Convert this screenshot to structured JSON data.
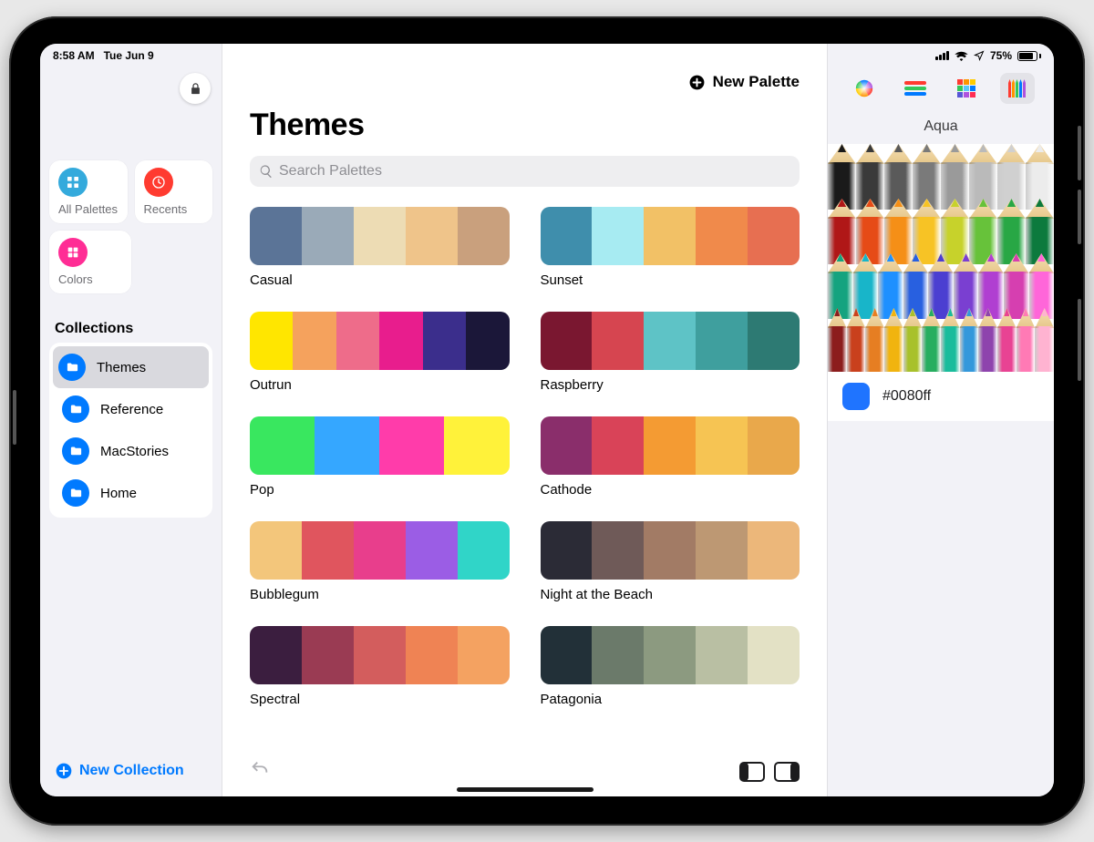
{
  "status": {
    "time": "8:58 AM",
    "date": "Tue Jun 9",
    "battery_pct": "75%"
  },
  "sidebar": {
    "tiles": [
      {
        "label": "All Palettes",
        "icon": "grid-icon",
        "color": "#34aadc"
      },
      {
        "label": "Recents",
        "icon": "clock-icon",
        "color": "#ff3b30"
      },
      {
        "label": "Colors",
        "icon": "swatch-icon",
        "color": "#ff2d95"
      }
    ],
    "section_title": "Collections",
    "collections": [
      {
        "label": "Themes",
        "selected": true
      },
      {
        "label": "Reference",
        "selected": false
      },
      {
        "label": "MacStories",
        "selected": false
      },
      {
        "label": "Home",
        "selected": false
      }
    ],
    "new_collection_label": "New Collection"
  },
  "main": {
    "new_palette_label": "New Palette",
    "title": "Themes",
    "search_placeholder": "Search Palettes",
    "palettes": [
      {
        "name": "Casual",
        "colors": [
          "#5b7497",
          "#9aaab8",
          "#eddcb4",
          "#efc48a",
          "#c9a07d"
        ]
      },
      {
        "name": "Sunset",
        "colors": [
          "#3f8eac",
          "#a7ebf2",
          "#f2c166",
          "#f08a4b",
          "#e76f51"
        ]
      },
      {
        "name": "Outrun",
        "colors": [
          "#ffe600",
          "#f5a25d",
          "#ee6c8a",
          "#e81d8d",
          "#3b2e8c",
          "#1b1739"
        ]
      },
      {
        "name": "Raspberry",
        "colors": [
          "#7a1730",
          "#d64550",
          "#5ec3c6",
          "#3f9f9e",
          "#2d7a73"
        ]
      },
      {
        "name": "Pop",
        "colors": [
          "#39e75f",
          "#35a7ff",
          "#ff3caa",
          "#fff23a"
        ]
      },
      {
        "name": "Cathode",
        "colors": [
          "#8a2e6b",
          "#d94358",
          "#f49b33",
          "#f6c453",
          "#e9a84b"
        ]
      },
      {
        "name": "Bubblegum",
        "colors": [
          "#f3c67b",
          "#e0555e",
          "#e83e8c",
          "#9b5de5",
          "#30d5c8"
        ]
      },
      {
        "name": "Night at the Beach",
        "colors": [
          "#2b2b36",
          "#6f5a58",
          "#a27b65",
          "#bd9873",
          "#ecb77a"
        ]
      },
      {
        "name": "Spectral",
        "colors": [
          "#3b1e3f",
          "#9a3b53",
          "#d35d5d",
          "#ef8354",
          "#f4a261"
        ]
      },
      {
        "name": "Patagonia",
        "colors": [
          "#223038",
          "#6b7a6a",
          "#8c9a80",
          "#b9bfa3",
          "#e3e1c5"
        ]
      }
    ]
  },
  "inspector": {
    "title": "Aqua",
    "selected_hex": "#0080ff",
    "chip_color": "#1f74ff",
    "pencil_rows": [
      [
        "#1a1a1a",
        "#3a3a3a",
        "#5a5a5a",
        "#7a7a7a",
        "#9a9a9a",
        "#bababa",
        "#d0d0d0",
        "#ececec"
      ],
      [
        "#b01717",
        "#e64b17",
        "#f58f17",
        "#f7c325",
        "#c7d22b",
        "#67c23a",
        "#28a745",
        "#0c7a3d"
      ],
      [
        "#15a37f",
        "#18b5c9",
        "#1e90ff",
        "#2860e0",
        "#4b3fd1",
        "#7a3fd1",
        "#b03fd1",
        "#d63fb0",
        "#ff66d9"
      ],
      [
        "#8c1d1d",
        "#c9401d",
        "#e67e22",
        "#f1b40f",
        "#a8c12b",
        "#27ae60",
        "#1abc9c",
        "#3498db",
        "#8e44ad",
        "#e84393",
        "#ff7ab5",
        "#ffb3d1"
      ]
    ]
  }
}
